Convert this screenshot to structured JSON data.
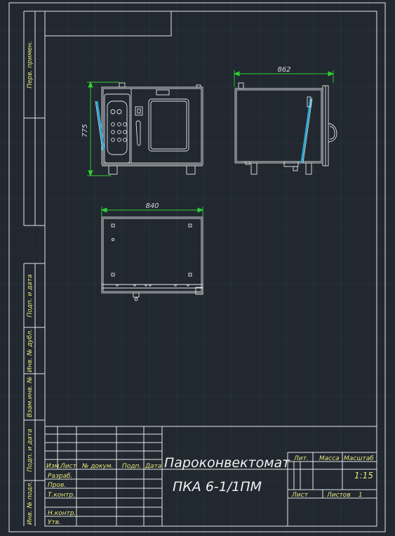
{
  "title_block": {
    "title_line1": "Пароконвектомат",
    "title_line2": "ПКА 6-1/1ПМ",
    "col_izm": "Изм.",
    "col_list": "Лист",
    "col_doc": "№ докум.",
    "col_sign": "Подп.",
    "col_date": "Дата",
    "row_razrab": "Разраб.",
    "row_prov": "Пров.",
    "row_tkontr": "Т.контр.",
    "row_nkontr": "Н.контр.",
    "row_utv": "Утв.",
    "lit": "Лит.",
    "massa": "Масса",
    "masshtab": "Масштаб",
    "scale_value": "1:15",
    "sheet": "Лист",
    "sheets": "Листов",
    "sheets_value": "1"
  },
  "side_stamp": {
    "perv_primen": "Перв. примен.",
    "podp_data_1": "Подп. и дата",
    "inv_dubl": "Инв. № дубл.",
    "vzam_inv": "Взам.инв. №",
    "podp_data_2": "Подп. и дата",
    "inv_podl": "Инв. № подл."
  },
  "dimensions": {
    "front_height": "775",
    "side_depth": "862",
    "top_width": "840"
  },
  "colors": {
    "background": "#212830",
    "frame": "#e8e8e8",
    "grid": "#2e363f",
    "dimension": "#2fd12f",
    "label": "#e6e67a",
    "glass": "#2fa7d6"
  }
}
